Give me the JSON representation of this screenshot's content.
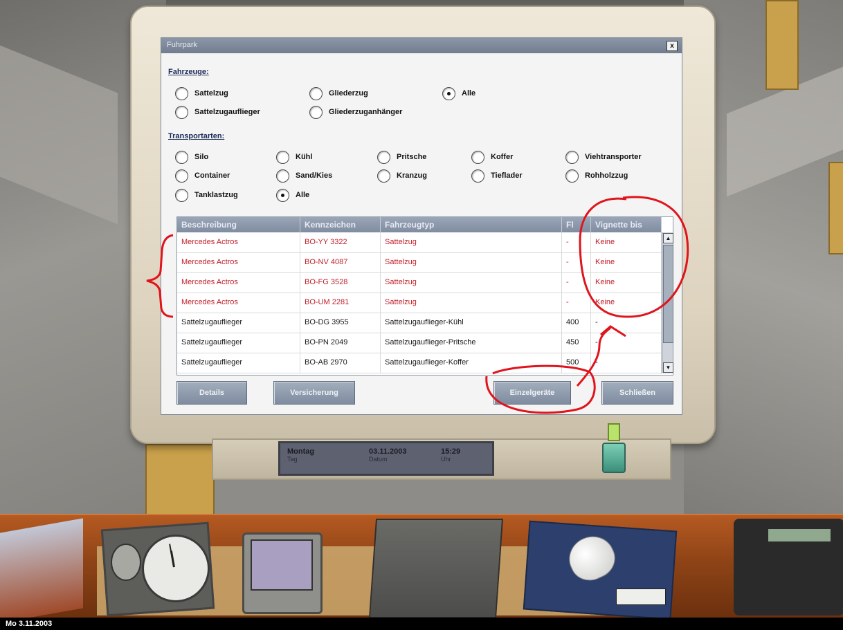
{
  "window": {
    "title": "Fuhrpark",
    "close_label": "x"
  },
  "filters": {
    "vehicles_label": "Fahrzeuge:",
    "vehicles": [
      {
        "label": "Sattelzug",
        "checked": false
      },
      {
        "label": "Gliederzug",
        "checked": false
      },
      {
        "label": "Alle",
        "checked": true
      },
      {
        "label": "Sattelzugauflieger",
        "checked": false
      },
      {
        "label": "Gliederzuganhänger",
        "checked": false
      }
    ],
    "transport_label": "Transportarten:",
    "transport": [
      {
        "label": "Silo",
        "checked": false
      },
      {
        "label": "Kühl",
        "checked": false
      },
      {
        "label": "Pritsche",
        "checked": false
      },
      {
        "label": "Koffer",
        "checked": false
      },
      {
        "label": "Viehtransporter",
        "checked": false
      },
      {
        "label": "Container",
        "checked": false
      },
      {
        "label": "Sand/Kies",
        "checked": false
      },
      {
        "label": "Kranzug",
        "checked": false
      },
      {
        "label": "Tieflader",
        "checked": false
      },
      {
        "label": "Rohholzzug",
        "checked": false
      },
      {
        "label": "Tanklastzug",
        "checked": false
      },
      {
        "label": "Alle",
        "checked": true
      }
    ]
  },
  "table": {
    "columns": [
      "Beschreibung",
      "Kennzeichen",
      "Fahrzeugtyp",
      "Fl",
      "Vignette bis"
    ],
    "rows": [
      {
        "desc": "Mercedes Actros",
        "plate": "BO-YY 3322",
        "type": "Sattelzug",
        "fl": "-",
        "vignette": "Keine",
        "highlight": true
      },
      {
        "desc": "Mercedes Actros",
        "plate": "BO-NV 4087",
        "type": "Sattelzug",
        "fl": "-",
        "vignette": "Keine",
        "highlight": true
      },
      {
        "desc": "Mercedes Actros",
        "plate": "BO-FG 3528",
        "type": "Sattelzug",
        "fl": "-",
        "vignette": "Keine",
        "highlight": true
      },
      {
        "desc": "Mercedes Actros",
        "plate": "BO-UM 2281",
        "type": "Sattelzug",
        "fl": "-",
        "vignette": "Keine",
        "highlight": true
      },
      {
        "desc": "Sattelzugauflieger",
        "plate": "BO-DG 3955",
        "type": "Sattelzugauflieger-Kühl",
        "fl": "400",
        "vignette": "-",
        "highlight": false
      },
      {
        "desc": "Sattelzugauflieger",
        "plate": "BO-PN 2049",
        "type": "Sattelzugauflieger-Pritsche",
        "fl": "450",
        "vignette": "-",
        "highlight": false
      },
      {
        "desc": "Sattelzugauflieger",
        "plate": "BO-AB 2970",
        "type": "Sattelzugauflieger-Koffer",
        "fl": "500",
        "vignette": "-",
        "highlight": false
      }
    ]
  },
  "buttons": {
    "details": "Details",
    "insurance": "Versicherung",
    "accessories": "Einzelgeräte",
    "close": "Schließen"
  },
  "lcd": {
    "day": "Montag",
    "day_sub": "Tag",
    "date": "03.11.2003",
    "date_sub": "Datum",
    "time": "15:29",
    "time_sub": "Uhr"
  },
  "taskbar": {
    "date": "Mo 3.11.2003"
  },
  "colors": {
    "accent_red": "#c0202a",
    "header_blue": "#808c9f"
  }
}
